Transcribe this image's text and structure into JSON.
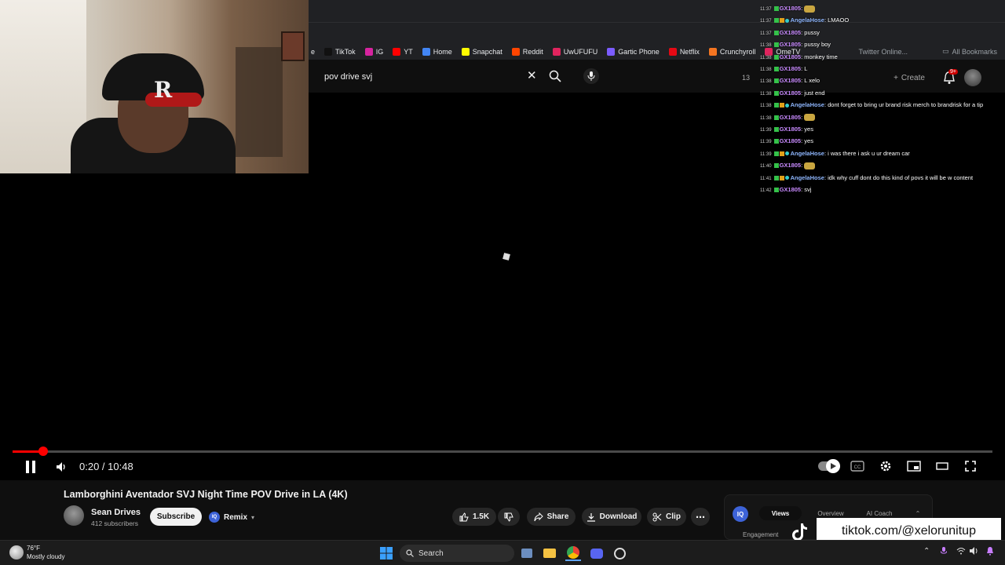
{
  "browser": {
    "bookmarks": [
      {
        "label": "e",
        "color": "#202124"
      },
      {
        "label": "TikTok",
        "color": "#111111"
      },
      {
        "label": "IG",
        "color": "#d6249f"
      },
      {
        "label": "YT",
        "color": "#ff0000"
      },
      {
        "label": "Home",
        "color": "#4285f4"
      },
      {
        "label": "Snapchat",
        "color": "#fffc00"
      },
      {
        "label": "Reddit",
        "color": "#ff4500"
      },
      {
        "label": "UwUFUFU",
        "color": "#e0245e"
      },
      {
        "label": "Gartic Phone",
        "color": "#7b5cff"
      },
      {
        "label": "Netflix",
        "color": "#e50914"
      },
      {
        "label": "Crunchyroll",
        "color": "#f47521"
      },
      {
        "label": "OmeTV",
        "color": "#e0245e"
      }
    ],
    "bookmarks_partial": "Twitter Online...",
    "all_bookmarks": "All Bookmarks"
  },
  "youtube": {
    "search_value": "pov drive svj",
    "create_label": "Create",
    "notif_count": "9+",
    "header_counter": "13"
  },
  "chat": [
    {
      "ts": "11:37",
      "user": "GX1805",
      "msg": "",
      "emote": true
    },
    {
      "ts": "11:37",
      "user": "AngelaHose",
      "msg": "LMAOO"
    },
    {
      "ts": "11:37",
      "user": "GX1805",
      "msg": "pussy"
    },
    {
      "ts": "11:38",
      "user": "GX1805",
      "msg": "pussy boy"
    },
    {
      "ts": "11:38",
      "user": "GX1805",
      "msg": "monkey time"
    },
    {
      "ts": "11:38",
      "user": "GX1805",
      "msg": "L"
    },
    {
      "ts": "11:38",
      "user": "GX1805",
      "msg": "L xelo"
    },
    {
      "ts": "11:38",
      "user": "GX1805",
      "msg": "just end"
    },
    {
      "ts": "11:38",
      "user": "AngelaHose",
      "msg": "dont forget to bring ur brand risk merch to brandrisk for a tip"
    },
    {
      "ts": "11:38",
      "user": "GX1805",
      "msg": "",
      "emote": true
    },
    {
      "ts": "11:39",
      "user": "GX1805",
      "msg": "yes"
    },
    {
      "ts": "11:39",
      "user": "GX1805",
      "msg": "yes"
    },
    {
      "ts": "11:39",
      "user": "AngelaHose",
      "msg": "i was there i ask u ur dream car"
    },
    {
      "ts": "11:40",
      "user": "GX1805",
      "msg": "",
      "emote": true
    },
    {
      "ts": "11:41",
      "user": "AngelaHose",
      "msg": "idk why cuff dont do this kind of povs it will be w content"
    },
    {
      "ts": "11:42",
      "user": "GX1805",
      "msg": "svj"
    }
  ],
  "player": {
    "time_current": "0:20",
    "time_total": "10:48",
    "time_display": "0:20 / 10:48",
    "progress_fraction": 0.031
  },
  "video": {
    "title": "Lamborghini Aventador SVJ Night Time POV Drive in LA (4K)",
    "channel": "Sean Drives",
    "subscribers": "412 subscribers",
    "subscribe_label": "Subscribe",
    "remix_label": "Remix",
    "like_count": "1.5K",
    "share_label": "Share",
    "download_label": "Download",
    "clip_label": "Clip"
  },
  "vidiq": {
    "logo": "IQ",
    "tabs": [
      "Views",
      "Overview",
      "AI Coach"
    ],
    "active_tab": "Views",
    "engagement_label": "Engagement"
  },
  "overlay": {
    "tiktok_handle": "tiktok.com/@xelorunitup"
  },
  "taskbar": {
    "temperature": "76°F",
    "weather": "Mostly cloudy",
    "search_label": "Search"
  },
  "colors": {
    "accent_red": "#ff0000",
    "gx_user": "#c98bff",
    "angela_user": "#8fb7ff"
  }
}
